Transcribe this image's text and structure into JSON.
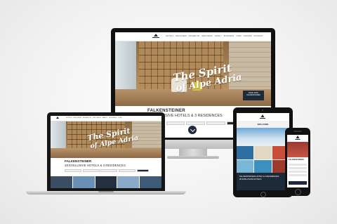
{
  "imac": {
    "nav": [
      "HOTELS",
      "REGIONEN",
      "ANGEBOTE",
      "WELLNESS",
      "FAMILY",
      "BUSINESS",
      "JOBS",
      "GRUPPE",
      "KONTAKT"
    ],
    "hero_script_line1": "The Spirit",
    "hero_script_line2": "of Alpe Adria",
    "hero_badge_line1": "BOOK NOW",
    "hero_badge_line2": "FALKENSTEINER",
    "brand": "FALKENSTEINER",
    "tagline": "28 EXKLUSIVE HOTELS & 3 RESIDENCES"
  },
  "laptop": {
    "nav": [
      "HOTELS",
      "REGIONEN",
      "ANGEBOTE",
      "WELLNESS",
      "FAMILY",
      "BUSINESS",
      "JOBS"
    ],
    "hero_script_line1": "The Spirit",
    "hero_script_line2": "of Alpe Adria",
    "brand": "FALKENSTEINER",
    "tagline": "28 EXKLUSIVE HOTELS & 3 RESIDENCES"
  },
  "tablet": {
    "welcome": "WELCOME",
    "footer_line1": "FALKENSTEINER HOTELS & RESIDENCES",
    "footer_line2": "28 EXKLUSIVE HOTELS"
  },
  "phone": {
    "title": "FALKENSTEINER"
  },
  "colors": {
    "brand_navy": "#1d2a3a",
    "wood": "#a88357",
    "background": "#f3f3f3"
  }
}
